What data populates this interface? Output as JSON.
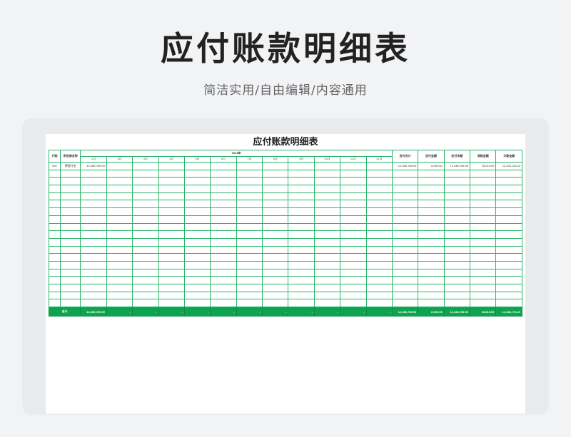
{
  "page": {
    "title": "应付账款明细表",
    "subtitle": "简洁实用/自由编辑/内容通用"
  },
  "sheet": {
    "title": "应付账款明细表",
    "headers": {
      "code": "代码",
      "supplier": "供应商名称",
      "year": "2023年",
      "months": [
        "1月",
        "2月",
        "3月",
        "4月",
        "5月",
        "6月",
        "7月",
        "8月",
        "9月",
        "10月",
        "11月",
        "12月"
      ],
      "payable_total": "应付合计",
      "paid_amount": "应付金额",
      "payable_balance": "应付余额",
      "collect_amount": "收款金额",
      "settled_amount": "欠款金额"
    },
    "row1": {
      "code": "001",
      "supplier": "德塔什金",
      "jan": "12,456,789.00",
      "payable_total": "12,456,789.00",
      "paid_amount": "8,000.00",
      "payable_balance": "12,448,789.00",
      "collect_amount": "15,015.00",
      "settled_amount": "12,443,115.20"
    },
    "totals": {
      "label": "合计",
      "jan": "12,456,789.00",
      "dash": "-",
      "payable_total": "12,456,789.00",
      "paid_amount": "8,000.00",
      "payable_balance": "12,448,789.00",
      "collect_amount": "15,815.00",
      "settled_amount": "12,443,773.20"
    }
  }
}
